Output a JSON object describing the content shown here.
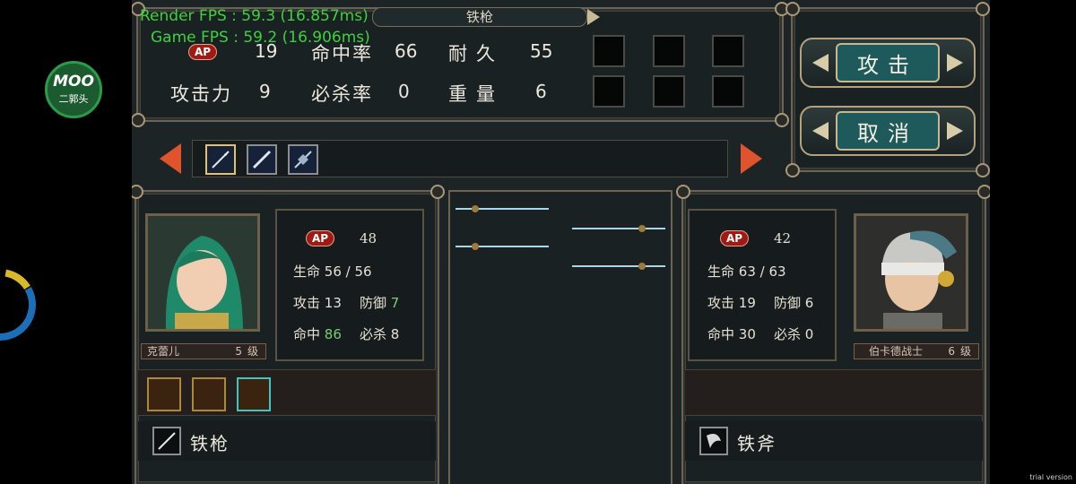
{
  "overlay": {
    "render_fps": "Render FPS : 59.3 (16.857ms)",
    "game_fps": "Game FPS : 59.2 (16.906ms)",
    "logo_main": "MOO",
    "logo_sub": "二郭头",
    "trial": "trial version"
  },
  "weapon_info": {
    "name": "铁枪",
    "ap_label": "AP",
    "ap_value": "19",
    "attack_label": "攻击力",
    "attack_value": "9",
    "hit_label": "命中率",
    "hit_value": "66",
    "crit_label": "必杀率",
    "crit_value": "0",
    "durability_label": "耐久",
    "durability_value": "55",
    "weight_label": "重量",
    "weight_value": "6"
  },
  "buttons": {
    "attack": "攻击",
    "cancel": "取消"
  },
  "player": {
    "name": "克蕾儿",
    "level": "5",
    "level_unit": "级",
    "ap_label": "AP",
    "ap": "48",
    "hp_label": "生命",
    "hp": "56 / 56",
    "atk_label": "攻击",
    "atk": "13",
    "def_label": "防御",
    "def": "7",
    "hit_label": "命中",
    "hit": "86",
    "crit_label": "必杀",
    "crit": "8",
    "weapon": "铁枪"
  },
  "enemy": {
    "name": "伯卡德战士",
    "level": "6",
    "level_unit": "级",
    "ap_label": "AP",
    "ap": "42",
    "hp_label": "生命",
    "hp": "63 / 63",
    "atk_label": "攻击",
    "atk": "19",
    "def_label": "防御",
    "def": "6",
    "hit_label": "命中",
    "hit": "30",
    "crit_label": "必杀",
    "crit": "0",
    "weapon": "铁斧"
  },
  "colors": {
    "accent_teal": "#1e5a5c",
    "arrow_orange": "#e0542d",
    "ap_red": "#9e1a12",
    "buff_green": "#7ccb7c",
    "fps_green": "#3ed13e"
  }
}
